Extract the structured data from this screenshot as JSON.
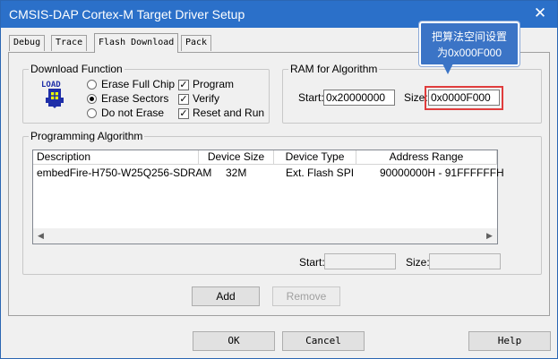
{
  "window": {
    "title": "CMSIS-DAP Cortex-M Target Driver Setup",
    "close_glyph": "✕"
  },
  "tabs": [
    {
      "label": "Debug",
      "active": false
    },
    {
      "label": "Trace",
      "active": false
    },
    {
      "label": "Flash Download",
      "active": true
    },
    {
      "label": "Pack",
      "active": false
    }
  ],
  "download_function": {
    "title": "Download Function",
    "icon_text": "LOAD",
    "radios": [
      {
        "label": "Erase Full Chip",
        "selected": false
      },
      {
        "label": "Erase Sectors",
        "selected": true
      },
      {
        "label": "Do not Erase",
        "selected": false
      }
    ],
    "checks": [
      {
        "label": "Program",
        "checked": true
      },
      {
        "label": "Verify",
        "checked": true
      },
      {
        "label": "Reset and Run",
        "checked": true
      }
    ],
    "check_glyph": "✓"
  },
  "ram": {
    "title": "RAM for Algorithm",
    "start_label": "Start:",
    "start_value": "0x20000000",
    "size_label": "Size:",
    "size_value": "0x0000F000"
  },
  "callout": {
    "line1": "把算法空间设置",
    "line2": "为0x000F000"
  },
  "programming_algorithm": {
    "title": "Programming Algorithm",
    "columns": [
      "Description",
      "Device Size",
      "Device Type",
      "Address Range"
    ],
    "rows": [
      {
        "description": "embedFire-H750-W25Q256-SDRAM",
        "size": "32M",
        "type": "Ext. Flash SPI",
        "range": "90000000H - 91FFFFFFH"
      }
    ],
    "start_label": "Start:",
    "size_label": "Size:",
    "scroll_left": "◀",
    "scroll_right": "▶"
  },
  "buttons": {
    "add": "Add",
    "remove": "Remove",
    "ok": "OK",
    "cancel": "Cancel",
    "help": "Help"
  },
  "colors": {
    "titlebar": "#2b70c9",
    "callout": "#3b74c6",
    "highlight": "#e03c3c"
  }
}
